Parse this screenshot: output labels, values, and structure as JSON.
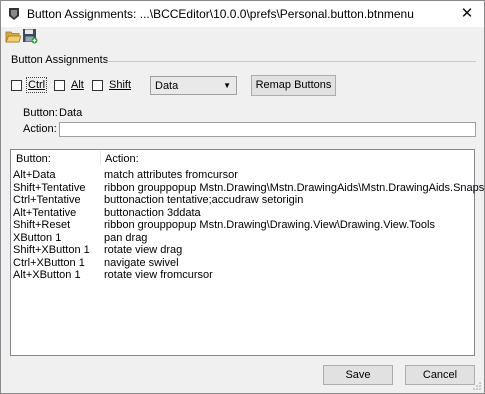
{
  "window": {
    "title": "Button Assignments: ...\\BCCEditor\\10.0.0\\prefs\\Personal.button.btnmenu",
    "close_label": "✕"
  },
  "toolbar": {
    "open_icon": "folder-open-icon",
    "save_icon": "save-disk-icon"
  },
  "group": {
    "label": "Button Assignments"
  },
  "modifiers": [
    {
      "label": "Ctrl",
      "checked": false
    },
    {
      "label": "Alt",
      "checked": false
    },
    {
      "label": "Shift",
      "checked": false
    }
  ],
  "dropdown": {
    "value": "Data"
  },
  "remap_label": "Remap Buttons",
  "button_field": {
    "label": "Button:",
    "value": "Data"
  },
  "action_field": {
    "label": "Action:",
    "value": ""
  },
  "list": {
    "columns": [
      "Button:",
      "Action:"
    ],
    "rows": [
      [
        "Alt+Data",
        "match attributes fromcursor"
      ],
      [
        "Shift+Tentative",
        "ribbon grouppopup Mstn.Drawing\\Mstn.DrawingAids\\Mstn.DrawingAids.Snaps"
      ],
      [
        "Ctrl+Tentative",
        "buttonaction tentative;accudraw setorigin"
      ],
      [
        "Alt+Tentative",
        "buttonaction 3ddata"
      ],
      [
        "Shift+Reset",
        "ribbon grouppopup Mstn.Drawing\\Drawing.View\\Drawing.View.Tools"
      ],
      [
        "XButton 1",
        "pan drag"
      ],
      [
        "Shift+XButton 1",
        "rotate view drag"
      ],
      [
        "Ctrl+XButton 1",
        "navigate swivel"
      ],
      [
        "Alt+XButton 1",
        "rotate view fromcursor"
      ]
    ]
  },
  "footer": {
    "save_label": "Save",
    "cancel_label": "Cancel"
  }
}
